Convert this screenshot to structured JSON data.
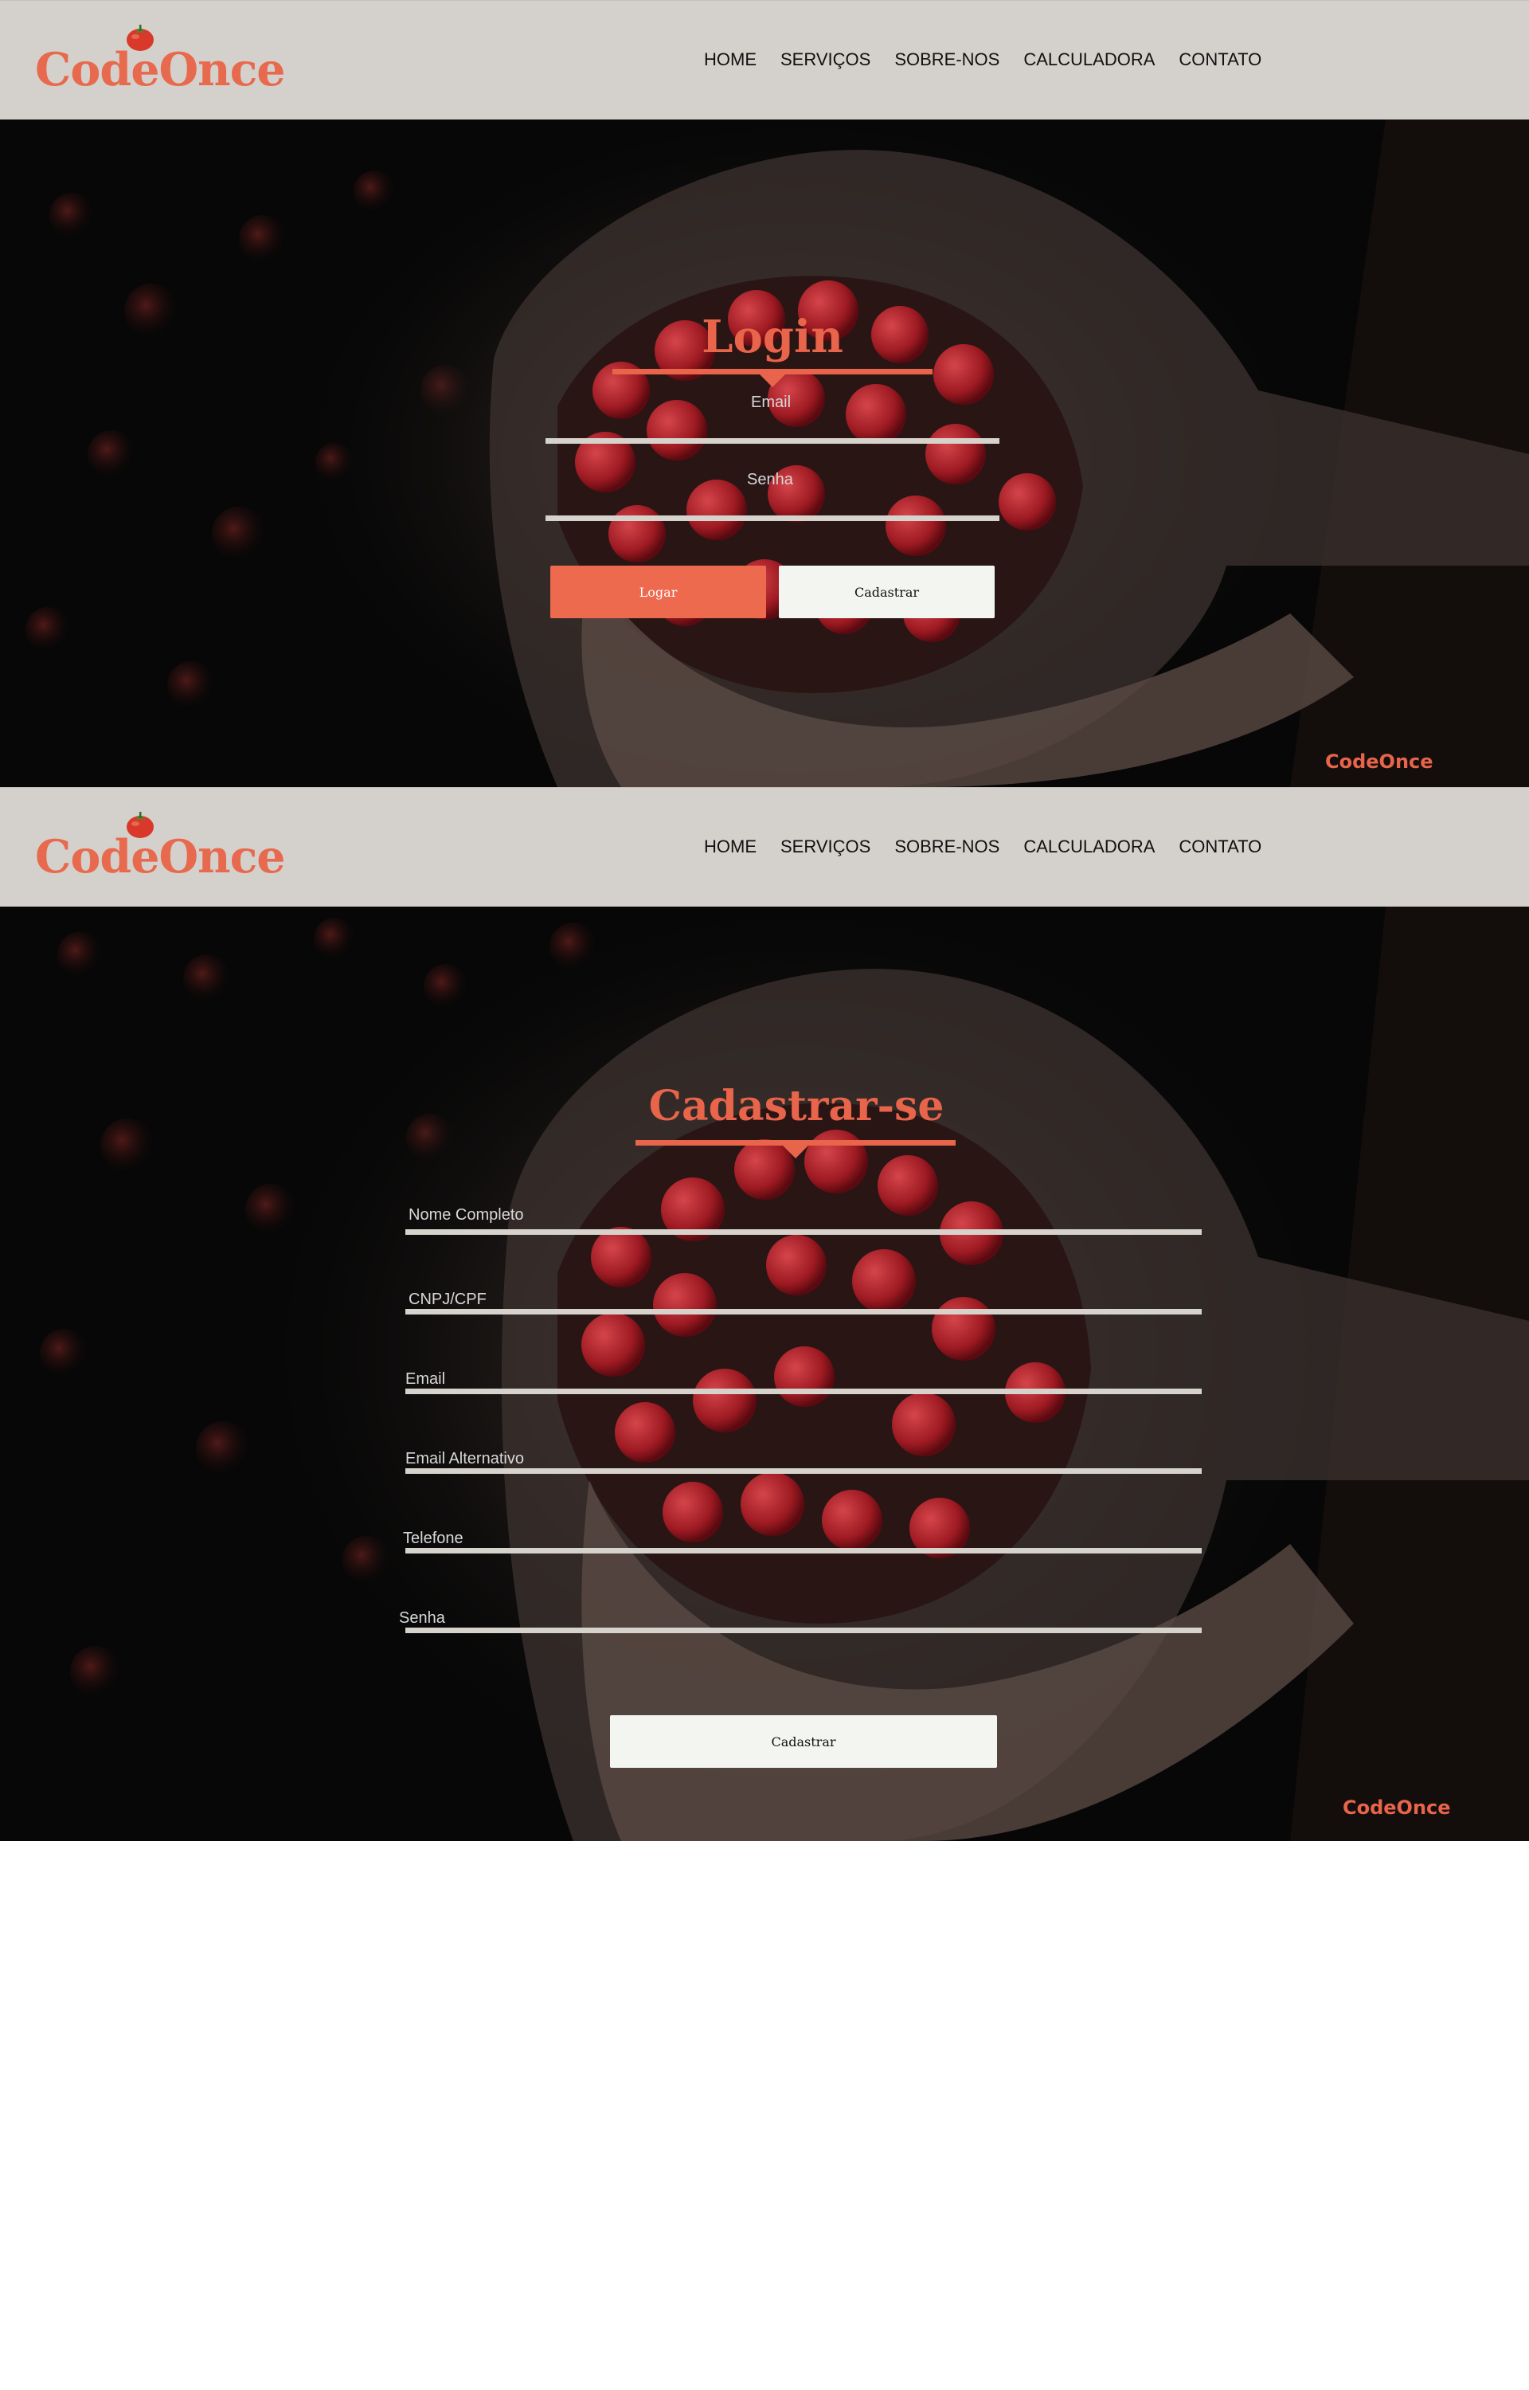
{
  "brand": {
    "name": "CodeOnce",
    "logo_icon": "tomato-icon",
    "color": "#e86a4e"
  },
  "nav": {
    "items": [
      {
        "label": "HOME"
      },
      {
        "label": "SERVIÇOS"
      },
      {
        "label": "SOBRE-NOS"
      },
      {
        "label": "CALCULADORA"
      },
      {
        "label": "CONTATO"
      }
    ]
  },
  "login": {
    "title": "Login",
    "fields": [
      {
        "label": "Email",
        "value": ""
      },
      {
        "label": "Senha",
        "value": ""
      }
    ],
    "primary_button": "Logar",
    "secondary_button": "Cadastrar",
    "footer_brand": "CodeOnce"
  },
  "register": {
    "title": "Cadastrar-se",
    "fields": [
      {
        "label": "Nome Completo",
        "value": ""
      },
      {
        "label": "CNPJ/CPF",
        "value": ""
      },
      {
        "label": "Email",
        "value": ""
      },
      {
        "label": "Email Alternativo",
        "value": ""
      },
      {
        "label": "Telefone",
        "value": ""
      },
      {
        "label": "Senha",
        "value": ""
      }
    ],
    "submit_button": "Cadastrar",
    "footer_brand": "CodeOnce"
  },
  "colors": {
    "accent": "#e8644a",
    "header_bg": "#d4d1cc",
    "hero_bg": "#070707",
    "field_line": "#d6d2cc",
    "light_button": "#f3f5f1"
  },
  "hero_image": "hands-holding-cherry-tomatoes-photo"
}
